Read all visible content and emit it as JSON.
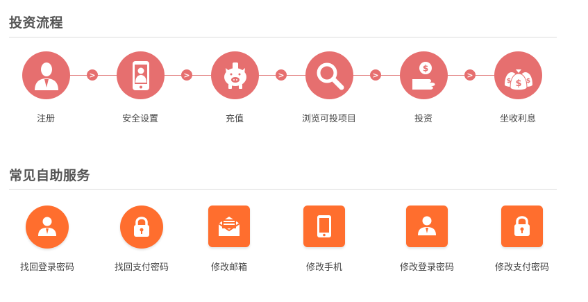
{
  "process": {
    "title": "投资流程",
    "steps": [
      {
        "label": "注册",
        "icon": "person-icon"
      },
      {
        "label": "安全设置",
        "icon": "phone-user-icon"
      },
      {
        "label": "充值",
        "icon": "piggy-bank-icon"
      },
      {
        "label": "浏览可投项目",
        "icon": "magnifier-icon"
      },
      {
        "label": "投资",
        "icon": "hand-coin-icon"
      },
      {
        "label": "坐收利息",
        "icon": "money-bags-icon"
      }
    ],
    "arrow_glyph": ">"
  },
  "services": {
    "title": "常见自助服务",
    "items": [
      {
        "label": "找回登录密码",
        "icon": "user-icon"
      },
      {
        "label": "找回支付密码",
        "icon": "lock-icon"
      },
      {
        "label": "修改邮箱",
        "icon": "envelope-icon"
      },
      {
        "label": "修改手机",
        "icon": "mobile-icon"
      },
      {
        "label": "修改登录密码",
        "icon": "user-icon"
      },
      {
        "label": "修改支付密码",
        "icon": "lock-icon"
      }
    ]
  },
  "colors": {
    "process_accent": "#e66f6f",
    "service_accent": "#ff6e2e",
    "text": "#444444"
  }
}
